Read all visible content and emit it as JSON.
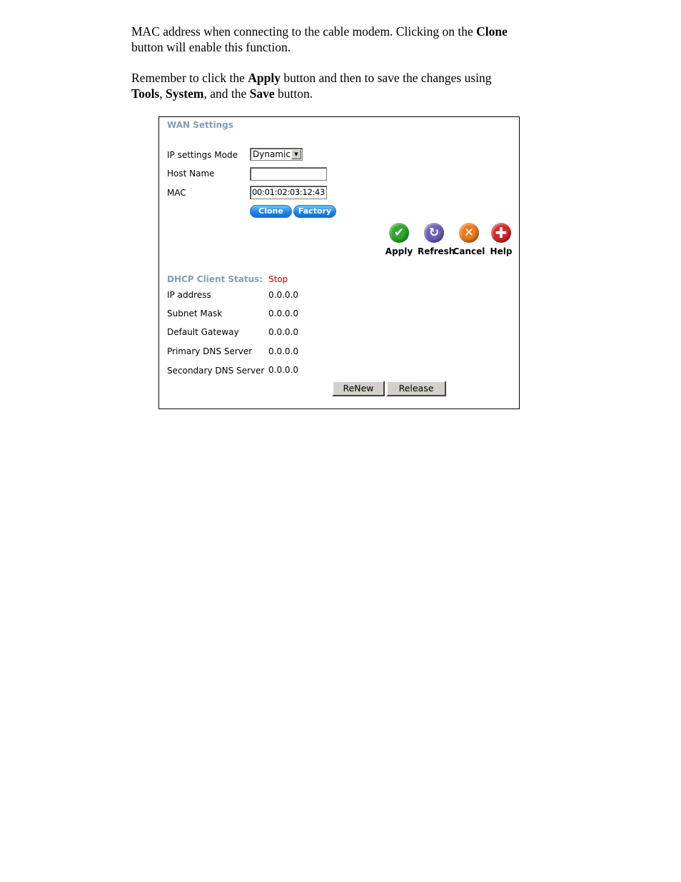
{
  "document": {
    "paragraph1": {
      "text_before": "MAC address when connecting to the cable modem.  Clicking on the ",
      "bold_clone": "Clone",
      "text_after": " button will enable this function."
    },
    "paragraph2": {
      "text1": "Remember to click the ",
      "bold_apply": "Apply",
      "text2": " button and then to save the changes using",
      "bold_tools": "Tools",
      "text3": ", ",
      "bold_system": "System",
      "text4": ", and the ",
      "bold_save": "Save",
      "text5": " button."
    }
  },
  "wan": {
    "title": "WAN Settings",
    "ip_mode_label": "IP settings Mode",
    "ip_mode_value": "Dynamic",
    "host_name_label": "Host Name",
    "host_name_value": "",
    "mac_label": "MAC",
    "mac_value": "00:01:02:03:12:43",
    "clone_label": "Clone",
    "factory_label": "Factory",
    "actions": {
      "apply": "Apply",
      "refresh": "Refresh",
      "cancel": "Cancel",
      "help": "Help"
    },
    "icons": {
      "apply": "check-icon",
      "refresh": "refresh-icon",
      "cancel": "x-icon",
      "help": "plus-icon"
    },
    "colors": {
      "apply": "#2fa82f",
      "refresh": "#6f5fb8",
      "cancel": "#f07a1a",
      "help": "#d8262a",
      "section_title": "#7f9db9",
      "status_stop": "#c00000"
    }
  },
  "dhcp": {
    "status_label": "DHCP Client Status:",
    "status_value": "Stop",
    "rows": [
      {
        "label": "IP address",
        "value": "0.0.0.0"
      },
      {
        "label": "Subnet Mask",
        "value": "0.0.0.0"
      },
      {
        "label": "Default Gateway",
        "value": "0.0.0.0"
      },
      {
        "label": "Primary DNS Server",
        "value": "0.0.0.0"
      },
      {
        "label": "Secondary DNS Server",
        "value": "0.0.0.0"
      }
    ],
    "renew_label": "ReNew",
    "release_label": "Release"
  }
}
